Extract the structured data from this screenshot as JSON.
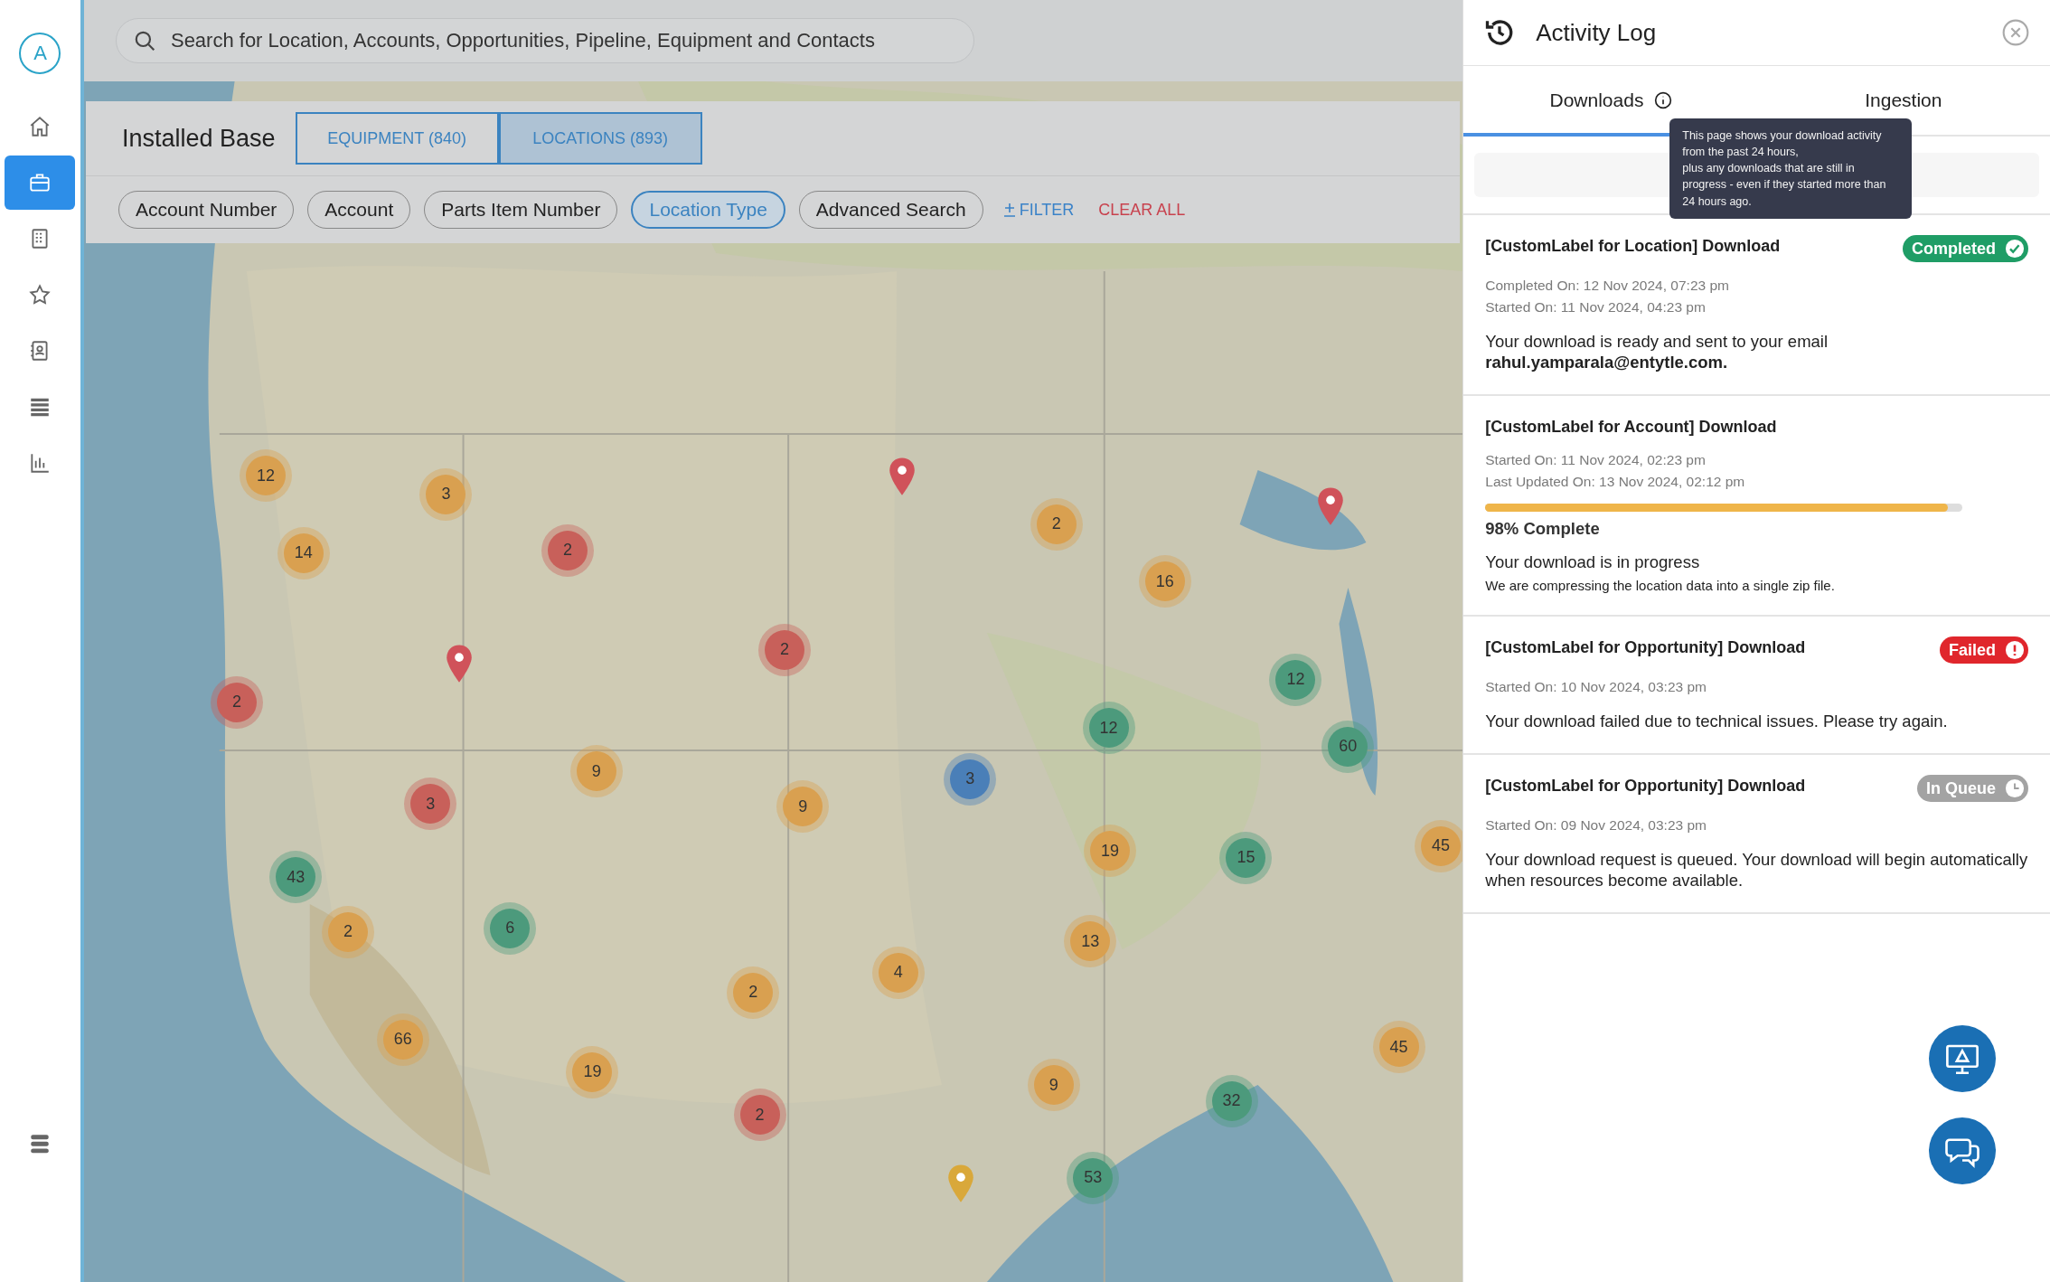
{
  "sidebar": {
    "avatar": "A",
    "items": [
      {
        "selected": false
      },
      {
        "selected": true
      },
      {
        "selected": false
      },
      {
        "selected": false
      },
      {
        "selected": false
      },
      {
        "selected": false
      },
      {
        "selected": false
      }
    ]
  },
  "search": {
    "placeholder": "Search for Location, Accounts, Opportunities, Pipeline, Equipment and Contacts"
  },
  "installed_base": {
    "title": "Installed Base",
    "tabs": [
      {
        "label": "EQUIPMENT (840)",
        "selected": false
      },
      {
        "label": "LOCATIONS (893)",
        "selected": true
      }
    ],
    "filters": [
      {
        "label": "Account Number",
        "selected": false
      },
      {
        "label": "Account",
        "selected": false
      },
      {
        "label": "Parts Item Number",
        "selected": false
      },
      {
        "label": "Location Type",
        "selected": true
      },
      {
        "label": "Advanced Search",
        "selected": false
      }
    ],
    "add_filter": "FILTER",
    "clear_all": "CLEAR ALL"
  },
  "map": {
    "clusters": [
      {
        "count": "12",
        "color": "#d9a050"
      },
      {
        "count": "3",
        "color": "#d9a050"
      },
      {
        "count": "14",
        "color": "#d9a050"
      },
      {
        "count": "2",
        "color": "#c8605a"
      },
      {
        "count": "2",
        "color": "#c8605a"
      },
      {
        "count": "2",
        "color": "#c8605a"
      },
      {
        "count": "9",
        "color": "#d9a050"
      },
      {
        "count": "3",
        "color": "#c8605a"
      },
      {
        "count": "9",
        "color": "#d9a050"
      },
      {
        "count": "3",
        "color": "#4a7fb8"
      },
      {
        "count": "43",
        "color": "#4c9a7c"
      },
      {
        "count": "2",
        "color": "#d9a050"
      },
      {
        "count": "6",
        "color": "#4c9a7c"
      },
      {
        "count": "66",
        "color": "#d9a050"
      },
      {
        "count": "19",
        "color": "#d9a050"
      },
      {
        "count": "2",
        "color": "#d9a050"
      },
      {
        "count": "4",
        "color": "#d9a050"
      },
      {
        "count": "2",
        "color": "#c8605a"
      },
      {
        "count": "9",
        "color": "#d9a050"
      },
      {
        "count": "53",
        "color": "#4c9a7c"
      },
      {
        "count": "13",
        "color": "#d9a050"
      },
      {
        "count": "19",
        "color": "#d9a050"
      },
      {
        "count": "12",
        "color": "#4c9a7c"
      },
      {
        "count": "2",
        "color": "#d9a050"
      },
      {
        "count": "16",
        "color": "#d9a050"
      },
      {
        "count": "12",
        "color": "#4c9a7c"
      },
      {
        "count": "60",
        "color": "#4c9a7c"
      },
      {
        "count": "15",
        "color": "#4c9a7c"
      },
      {
        "count": "45",
        "color": "#d9a050"
      },
      {
        "count": "45",
        "color": "#d9a050"
      },
      {
        "count": "32",
        "color": "#4c9a7c"
      }
    ],
    "pins": [
      {
        "color": "#d0525a"
      },
      {
        "color": "#d0525a"
      },
      {
        "color": "#d0525a"
      },
      {
        "color": "#d9a83a"
      }
    ]
  },
  "activity_log": {
    "title": "Activity Log",
    "tabs": [
      {
        "label": "Downloads",
        "selected": true
      },
      {
        "label": "Ingestion",
        "selected": false
      }
    ],
    "tooltip": "This page shows your download activity from the past 24 hours,\nplus any downloads that are still in progress - even if they started more than 24 hours ago.",
    "items": [
      {
        "title": "[CustomLabel for Location] Download",
        "kind": "completed",
        "status": "Completed",
        "meta": [
          "Completed On: 12 Nov 2024, 07:23 pm",
          "Started On: 11 Nov 2024, 04:23 pm"
        ],
        "message": "Your download is ready and sent to your email",
        "email": "rahul.yamparala@entytle.com."
      },
      {
        "title": "[CustomLabel for Account] Download",
        "kind": "progress",
        "meta": [
          "Started On: 11 Nov 2024, 02:23 pm",
          "Last Updated On: 13 Nov 2024, 02:12 pm"
        ],
        "level": 0.97,
        "progress_label": "98% Complete",
        "message": "Your download is in progress",
        "note": "We are compressing the location data into a single zip file."
      },
      {
        "title": "[CustomLabel for Opportunity] Download",
        "kind": "failed",
        "status": "Failed",
        "meta": [
          "Started On: 10 Nov 2024, 03:23 pm"
        ],
        "message": "Your download failed due to technical issues. Please try again."
      },
      {
        "title": "[CustomLabel for Opportunity] Download",
        "kind": "queued",
        "status": "In Queue",
        "meta": [
          "Started On: 09 Nov 2024, 03:23 pm"
        ],
        "message": "Your download request is queued. Your download will begin automatically when resources become available."
      }
    ]
  }
}
